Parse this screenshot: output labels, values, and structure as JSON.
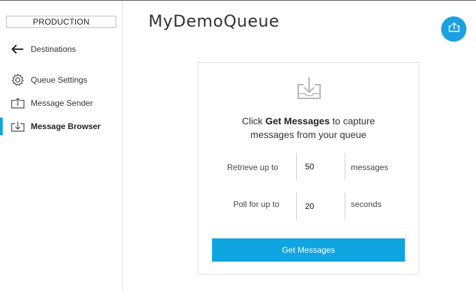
{
  "sidebar": {
    "environment": "PRODUCTION",
    "back": {
      "label": "Destinations",
      "icon": "arrow-left-icon"
    },
    "items": [
      {
        "label": "Queue Settings",
        "icon": "gear-icon",
        "active": false
      },
      {
        "label": "Message Sender",
        "icon": "send-tray-icon",
        "active": false
      },
      {
        "label": "Message Browser",
        "icon": "inbox-tray-icon",
        "active": true
      }
    ]
  },
  "header": {
    "title": "MyDemoQueue",
    "action_icon": "upload-icon"
  },
  "browser": {
    "icon": "inbox-download-icon",
    "prompt_prefix": "Click ",
    "prompt_bold": "Get Messages",
    "prompt_line1_suffix": " to capture",
    "prompt_line2": "messages from your queue",
    "retrieve": {
      "label": "Retrieve up to",
      "value": "50",
      "unit": "messages"
    },
    "poll": {
      "label": "Poll for up to",
      "value": "20",
      "unit": "seconds"
    },
    "button_label": "Get Messages"
  },
  "colors": {
    "accent": "#0ea5e0",
    "fab": "#1ba1e2",
    "sidebar_border": "#e1e1e1"
  }
}
